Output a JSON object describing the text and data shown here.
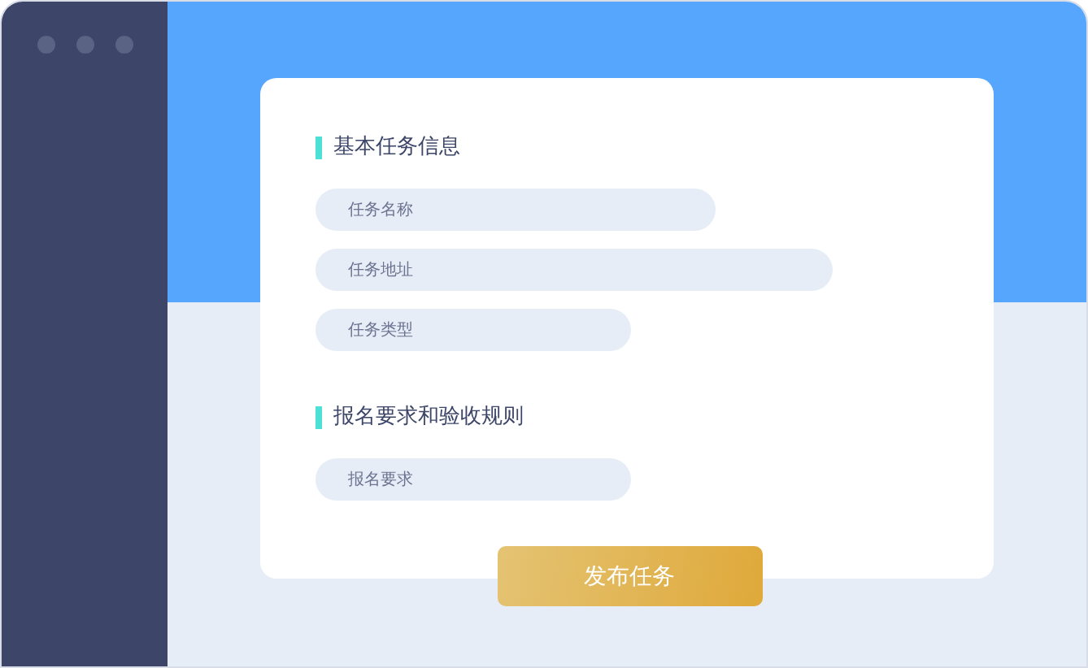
{
  "sections": [
    {
      "title": "基本任务信息",
      "fields": [
        {
          "placeholder": "任务名称"
        },
        {
          "placeholder": "任务地址"
        },
        {
          "placeholder": "任务类型"
        }
      ]
    },
    {
      "title": "报名要求和验收规则",
      "fields": [
        {
          "placeholder": "报名要求"
        }
      ]
    }
  ],
  "submit_button": "发布任务"
}
